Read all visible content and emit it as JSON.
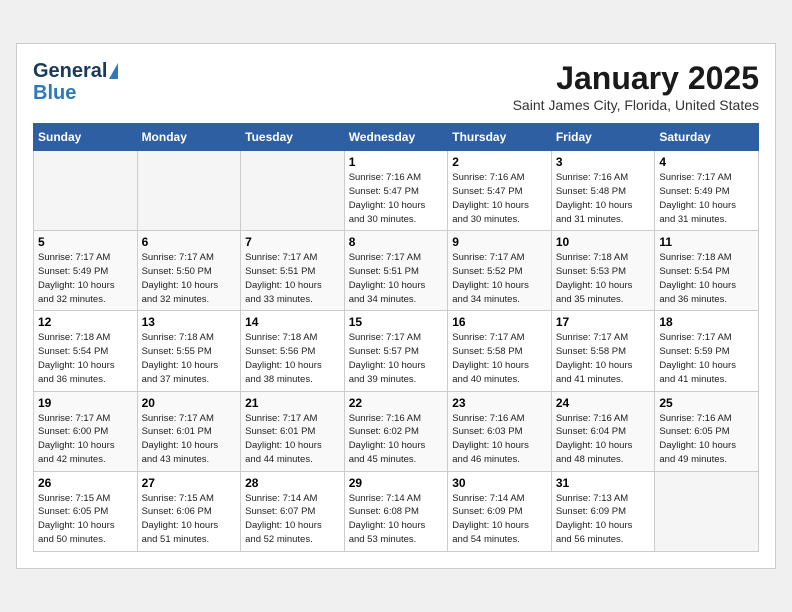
{
  "header": {
    "logo_line1": "General",
    "logo_line2": "Blue",
    "month_title": "January 2025",
    "location": "Saint James City, Florida, United States"
  },
  "weekdays": [
    "Sunday",
    "Monday",
    "Tuesday",
    "Wednesday",
    "Thursday",
    "Friday",
    "Saturday"
  ],
  "weeks": [
    [
      {
        "day": "",
        "sunrise": "",
        "sunset": "",
        "daylight": ""
      },
      {
        "day": "",
        "sunrise": "",
        "sunset": "",
        "daylight": ""
      },
      {
        "day": "",
        "sunrise": "",
        "sunset": "",
        "daylight": ""
      },
      {
        "day": "1",
        "sunrise": "Sunrise: 7:16 AM",
        "sunset": "Sunset: 5:47 PM",
        "daylight": "Daylight: 10 hours and 30 minutes."
      },
      {
        "day": "2",
        "sunrise": "Sunrise: 7:16 AM",
        "sunset": "Sunset: 5:47 PM",
        "daylight": "Daylight: 10 hours and 30 minutes."
      },
      {
        "day": "3",
        "sunrise": "Sunrise: 7:16 AM",
        "sunset": "Sunset: 5:48 PM",
        "daylight": "Daylight: 10 hours and 31 minutes."
      },
      {
        "day": "4",
        "sunrise": "Sunrise: 7:17 AM",
        "sunset": "Sunset: 5:49 PM",
        "daylight": "Daylight: 10 hours and 31 minutes."
      }
    ],
    [
      {
        "day": "5",
        "sunrise": "Sunrise: 7:17 AM",
        "sunset": "Sunset: 5:49 PM",
        "daylight": "Daylight: 10 hours and 32 minutes."
      },
      {
        "day": "6",
        "sunrise": "Sunrise: 7:17 AM",
        "sunset": "Sunset: 5:50 PM",
        "daylight": "Daylight: 10 hours and 32 minutes."
      },
      {
        "day": "7",
        "sunrise": "Sunrise: 7:17 AM",
        "sunset": "Sunset: 5:51 PM",
        "daylight": "Daylight: 10 hours and 33 minutes."
      },
      {
        "day": "8",
        "sunrise": "Sunrise: 7:17 AM",
        "sunset": "Sunset: 5:51 PM",
        "daylight": "Daylight: 10 hours and 34 minutes."
      },
      {
        "day": "9",
        "sunrise": "Sunrise: 7:17 AM",
        "sunset": "Sunset: 5:52 PM",
        "daylight": "Daylight: 10 hours and 34 minutes."
      },
      {
        "day": "10",
        "sunrise": "Sunrise: 7:18 AM",
        "sunset": "Sunset: 5:53 PM",
        "daylight": "Daylight: 10 hours and 35 minutes."
      },
      {
        "day": "11",
        "sunrise": "Sunrise: 7:18 AM",
        "sunset": "Sunset: 5:54 PM",
        "daylight": "Daylight: 10 hours and 36 minutes."
      }
    ],
    [
      {
        "day": "12",
        "sunrise": "Sunrise: 7:18 AM",
        "sunset": "Sunset: 5:54 PM",
        "daylight": "Daylight: 10 hours and 36 minutes."
      },
      {
        "day": "13",
        "sunrise": "Sunrise: 7:18 AM",
        "sunset": "Sunset: 5:55 PM",
        "daylight": "Daylight: 10 hours and 37 minutes."
      },
      {
        "day": "14",
        "sunrise": "Sunrise: 7:18 AM",
        "sunset": "Sunset: 5:56 PM",
        "daylight": "Daylight: 10 hours and 38 minutes."
      },
      {
        "day": "15",
        "sunrise": "Sunrise: 7:17 AM",
        "sunset": "Sunset: 5:57 PM",
        "daylight": "Daylight: 10 hours and 39 minutes."
      },
      {
        "day": "16",
        "sunrise": "Sunrise: 7:17 AM",
        "sunset": "Sunset: 5:58 PM",
        "daylight": "Daylight: 10 hours and 40 minutes."
      },
      {
        "day": "17",
        "sunrise": "Sunrise: 7:17 AM",
        "sunset": "Sunset: 5:58 PM",
        "daylight": "Daylight: 10 hours and 41 minutes."
      },
      {
        "day": "18",
        "sunrise": "Sunrise: 7:17 AM",
        "sunset": "Sunset: 5:59 PM",
        "daylight": "Daylight: 10 hours and 41 minutes."
      }
    ],
    [
      {
        "day": "19",
        "sunrise": "Sunrise: 7:17 AM",
        "sunset": "Sunset: 6:00 PM",
        "daylight": "Daylight: 10 hours and 42 minutes."
      },
      {
        "day": "20",
        "sunrise": "Sunrise: 7:17 AM",
        "sunset": "Sunset: 6:01 PM",
        "daylight": "Daylight: 10 hours and 43 minutes."
      },
      {
        "day": "21",
        "sunrise": "Sunrise: 7:17 AM",
        "sunset": "Sunset: 6:01 PM",
        "daylight": "Daylight: 10 hours and 44 minutes."
      },
      {
        "day": "22",
        "sunrise": "Sunrise: 7:16 AM",
        "sunset": "Sunset: 6:02 PM",
        "daylight": "Daylight: 10 hours and 45 minutes."
      },
      {
        "day": "23",
        "sunrise": "Sunrise: 7:16 AM",
        "sunset": "Sunset: 6:03 PM",
        "daylight": "Daylight: 10 hours and 46 minutes."
      },
      {
        "day": "24",
        "sunrise": "Sunrise: 7:16 AM",
        "sunset": "Sunset: 6:04 PM",
        "daylight": "Daylight: 10 hours and 48 minutes."
      },
      {
        "day": "25",
        "sunrise": "Sunrise: 7:16 AM",
        "sunset": "Sunset: 6:05 PM",
        "daylight": "Daylight: 10 hours and 49 minutes."
      }
    ],
    [
      {
        "day": "26",
        "sunrise": "Sunrise: 7:15 AM",
        "sunset": "Sunset: 6:05 PM",
        "daylight": "Daylight: 10 hours and 50 minutes."
      },
      {
        "day": "27",
        "sunrise": "Sunrise: 7:15 AM",
        "sunset": "Sunset: 6:06 PM",
        "daylight": "Daylight: 10 hours and 51 minutes."
      },
      {
        "day": "28",
        "sunrise": "Sunrise: 7:14 AM",
        "sunset": "Sunset: 6:07 PM",
        "daylight": "Daylight: 10 hours and 52 minutes."
      },
      {
        "day": "29",
        "sunrise": "Sunrise: 7:14 AM",
        "sunset": "Sunset: 6:08 PM",
        "daylight": "Daylight: 10 hours and 53 minutes."
      },
      {
        "day": "30",
        "sunrise": "Sunrise: 7:14 AM",
        "sunset": "Sunset: 6:09 PM",
        "daylight": "Daylight: 10 hours and 54 minutes."
      },
      {
        "day": "31",
        "sunrise": "Sunrise: 7:13 AM",
        "sunset": "Sunset: 6:09 PM",
        "daylight": "Daylight: 10 hours and 56 minutes."
      },
      {
        "day": "",
        "sunrise": "",
        "sunset": "",
        "daylight": ""
      }
    ]
  ]
}
